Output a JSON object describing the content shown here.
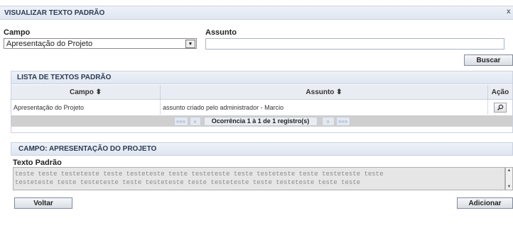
{
  "window": {
    "title": "VISUALIZAR TEXTO PADRÃO",
    "close_glyph": "x"
  },
  "filter": {
    "campo_label": "Campo",
    "campo_value": "Apresentação do Projeto",
    "assunto_label": "Assunto",
    "assunto_value": "",
    "search_button": "Buscar"
  },
  "list": {
    "title": "LISTA DE TEXTOS PADRÃO",
    "columns": [
      "Campo ⬍",
      "Assunto ⬍",
      "Ação"
    ],
    "rows": [
      {
        "campo": "Apresentação do Projeto",
        "assunto": "assunto criado pelo administrador - Marcio"
      }
    ],
    "pager": {
      "first": "«««",
      "prev": "«",
      "status": "Ocorrência 1 à 1 de 1 registro(s)",
      "next": "»",
      "last": "»»»"
    }
  },
  "detail": {
    "title": "CAMPO: APRESENTAÇÃO DO PROJETO",
    "label": "Texto Padrão",
    "text": "teste teste testeteste teste testeteste teste testeteste teste testeteste teste testeteste teste\ntesteteste teste testeteste teste testeteste teste testeteste teste testeteste teste teste"
  },
  "actions": {
    "back": "Voltar",
    "add": "Adicionar"
  }
}
